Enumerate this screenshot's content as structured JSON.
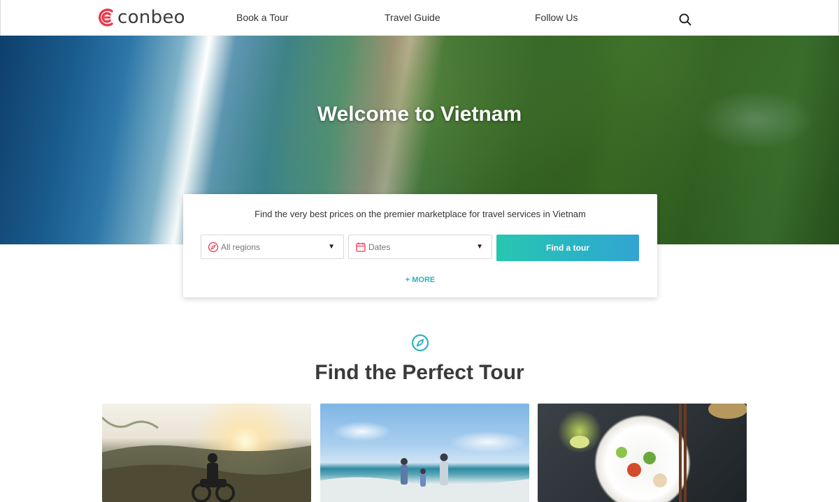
{
  "header": {
    "brand": "conbeo",
    "nav": [
      "Book a Tour",
      "Travel Guide",
      "Follow Us"
    ]
  },
  "hero": {
    "title": "Welcome to Vietnam"
  },
  "search": {
    "subtitle": "Find the very best prices on the premier marketplace for travel services in Vietnam",
    "regions_placeholder": "All regions",
    "dates_placeholder": "Dates",
    "submit_label": "Find a tour",
    "more_label": "+ MORE"
  },
  "section": {
    "title": "Find the Perfect Tour"
  },
  "colors": {
    "brand": "#e8394d",
    "accent": "#2bb3c0",
    "button_gradient_start": "#27c7b0",
    "button_gradient_end": "#33a4d3"
  },
  "icons": {
    "logo": "conbeo-logo-icon",
    "search": "search-icon",
    "regions": "compass-icon",
    "dates": "calendar-icon",
    "section": "compass-icon"
  }
}
